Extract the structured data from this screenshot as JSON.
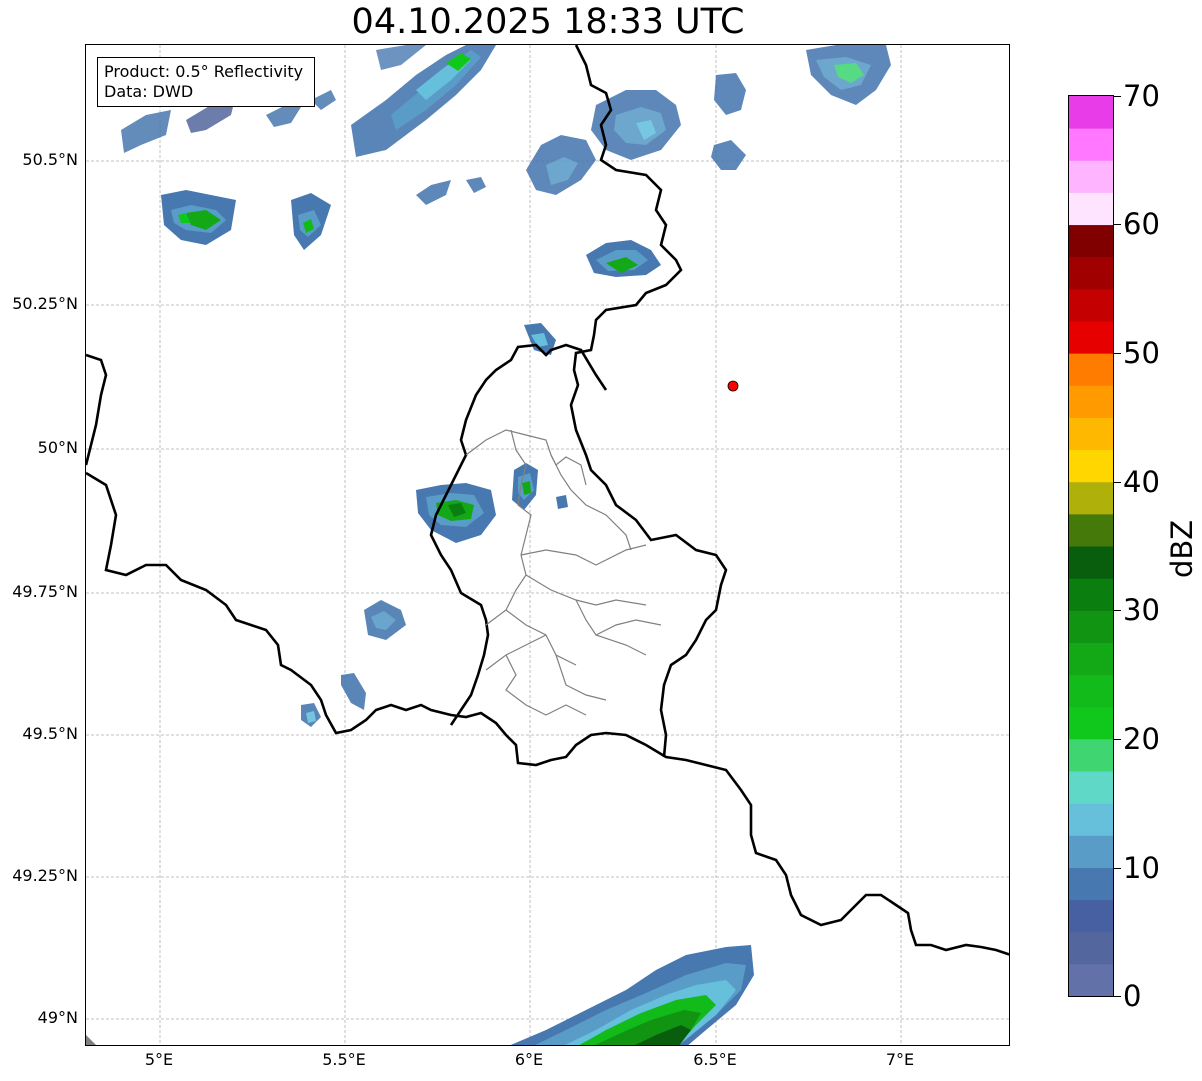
{
  "title": "04.10.2025 18:33 UTC",
  "info_box": {
    "product": "Product: 0.5° Reflectivity",
    "data": "Data: DWD"
  },
  "axes": {
    "lon_ticks": [
      "5°E",
      "5.5°E",
      "6°E",
      "6.5°E",
      "7°E"
    ],
    "lat_ticks": [
      "50.5°N",
      "50.25°N",
      "50°N",
      "49.75°N",
      "49.5°N",
      "49.25°N",
      "49°N"
    ],
    "grid": "dashed"
  },
  "colorbar": {
    "unit": "dBZ",
    "ticks": [
      "0",
      "10",
      "20",
      "30",
      "40",
      "50",
      "60",
      "70"
    ],
    "range": [
      0,
      70
    ],
    "colors": [
      "#6272a8",
      "#53679e",
      "#4660a1",
      "#4878b0",
      "#5a9cc8",
      "#66c0dc",
      "#5fd8c8",
      "#3fd672",
      "#10c81c",
      "#12ba1a",
      "#13a816",
      "#109412",
      "#0a7e0e",
      "#085e0c",
      "#457a0a",
      "#b0b00a",
      "#ffd600",
      "#ffb800",
      "#ff9a00",
      "#ff7c00",
      "#e60000",
      "#c40000",
      "#a00000",
      "#800000",
      "#ffe4ff",
      "#ffb4ff",
      "#ff78ff",
      "#e83ce8"
    ]
  },
  "marker": {
    "color": "#ff0000"
  },
  "colors": {
    "border": "#000000",
    "admin_border": "#808080",
    "grid": "#b0b0b0"
  }
}
